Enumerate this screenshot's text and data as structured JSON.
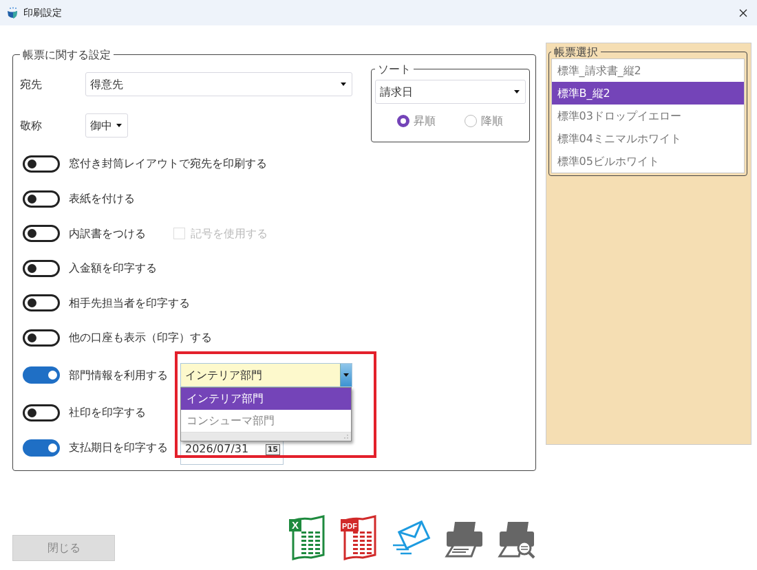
{
  "window": {
    "title": "印刷設定"
  },
  "form_settings": {
    "legend": "帳票に関する設定",
    "recipient": {
      "label": "宛先",
      "value": "得意先"
    },
    "honorific": {
      "label": "敬称",
      "value": "御中"
    },
    "sort": {
      "legend": "ソート",
      "value": "請求日",
      "options": [
        {
          "label": "昇順",
          "selected": true
        },
        {
          "label": "降順",
          "selected": false
        }
      ]
    },
    "toggles": [
      {
        "label": "窓付き封筒レイアウトで宛先を印刷する",
        "on": false
      },
      {
        "label": "表紙を付ける",
        "on": false
      },
      {
        "label": "内訳書をつける",
        "on": false,
        "checkbox": {
          "label": "記号を使用する",
          "checked": false,
          "disabled": true
        }
      },
      {
        "label": "入金額を印字する",
        "on": false
      },
      {
        "label": "相手先担当者を印字する",
        "on": false
      },
      {
        "label": "他の口座も表示（印字）する",
        "on": false
      },
      {
        "label": "部門情報を利用する",
        "on": true,
        "dropdown": {
          "value": "インテリア部門",
          "expanded": true,
          "options": [
            {
              "label": "インテリア部門",
              "selected": true
            },
            {
              "label": "コンシューマ部門",
              "selected": false
            }
          ]
        }
      },
      {
        "label": "社印を印字する",
        "on": false
      },
      {
        "label": "支払期日を印字する",
        "on": true,
        "date": {
          "value": "2026/07/31",
          "calendar_badge": "15"
        }
      }
    ]
  },
  "form_selection": {
    "legend": "帳票選択",
    "items": [
      {
        "label": "標準_請求書_縦2",
        "selected": false
      },
      {
        "label": "標準B_縦2",
        "selected": true
      },
      {
        "label": "標準03ドロップイエロー",
        "selected": false
      },
      {
        "label": "標準04ミニマルホワイト",
        "selected": false
      },
      {
        "label": "標準05ビルホワイト",
        "selected": false
      }
    ]
  },
  "close_button": {
    "label": "閉じる",
    "disabled": true
  },
  "toolbar": [
    {
      "kind": "excel",
      "badge": "X"
    },
    {
      "kind": "pdf",
      "badge": "PDF"
    },
    {
      "kind": "mail"
    },
    {
      "kind": "print"
    },
    {
      "kind": "preview"
    }
  ]
}
